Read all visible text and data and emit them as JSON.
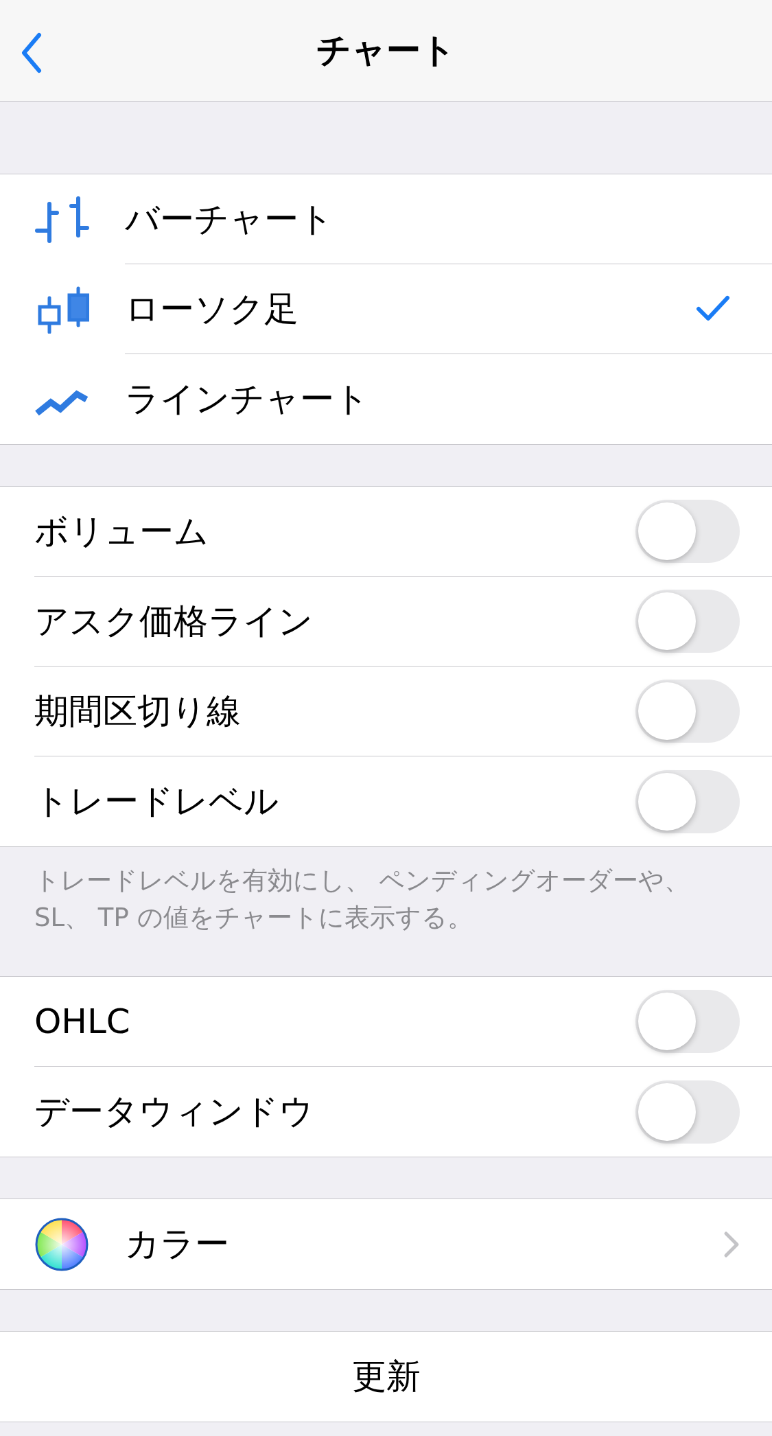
{
  "nav": {
    "title": "チャート"
  },
  "chart_types": [
    {
      "label": "バーチャート",
      "selected": false
    },
    {
      "label": "ローソク足",
      "selected": true
    },
    {
      "label": "ラインチャート",
      "selected": false
    }
  ],
  "toggles": [
    {
      "label": "ボリューム",
      "on": false
    },
    {
      "label": "アスク価格ライン",
      "on": false
    },
    {
      "label": "期間区切り線",
      "on": false
    },
    {
      "label": "トレードレベル",
      "on": false
    }
  ],
  "toggles_note": "トレードレベルを有効にし、 ペンディングオーダーや、 SL、 TP の値をチャートに表示する。",
  "toggles_2": [
    {
      "label": "OHLC",
      "on": false
    },
    {
      "label": "データウィンドウ",
      "on": false
    }
  ],
  "color_row": {
    "label": "カラー"
  },
  "refresh_button": "更新"
}
